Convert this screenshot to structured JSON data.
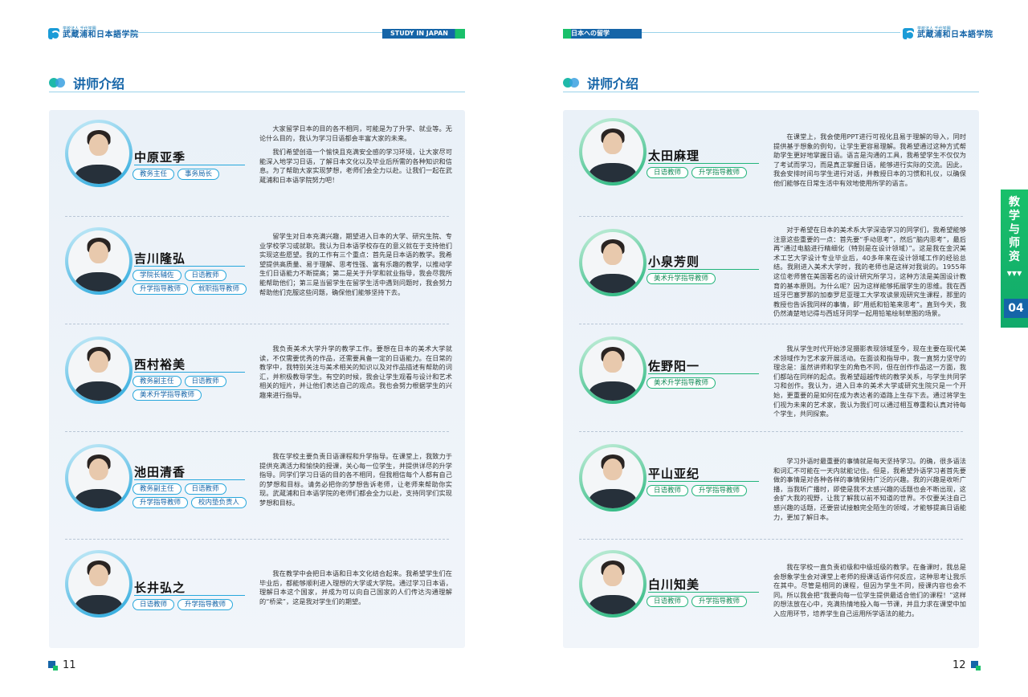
{
  "header": {
    "logo_small": "学校法人 千代学園",
    "logo_name": "武蔵浦和日本語学院",
    "left_tag": "STUDY IN JAPAN",
    "right_tag": "日本への留学"
  },
  "section_title": "讲师介绍",
  "side_tab": {
    "text": "教学与师资",
    "arrow": "▼▼▼",
    "number": "04"
  },
  "left_teachers": [
    {
      "name": "中原亚季",
      "tags": [
        "教务主任",
        "事务局长"
      ],
      "desc": [
        "大家留学日本的目的各不相同，可能是为了升学、就业等。无论什么目的，我认为学习日语都会丰富大家的未来。",
        "我们希望创造一个愉快且充满安全感的学习环境，让大家尽可能深入地学习日语，了解日本文化以及毕业后所需的各种知识和信息。为了帮助大家实现梦想，老师们会全力以赴。让我们一起在武蔵浦和日本语学院努力吧！"
      ]
    },
    {
      "name": "吉川隆弘",
      "tags": [
        "学院长辅佐",
        "日语教师",
        "升学指导教师",
        "就职指导教师"
      ],
      "desc": [
        "留学生对日本充满兴趣，期望进入日本的大学、研究生院、专业学校学习或就职。我认为日本语学校存在的意义就在于支持他们实现这些愿望。我的工作有三个重点：首先是日本语的教学。我希望提供高质量、易于理解、思考性强、富有乐趣的教学，以推动学生们日语能力不断提高；第二是关于升学和就业指导，我会尽我所能帮助他们；第三是当留学生在留学生活中遇到问题时，我会努力帮助他们克服这些问题，确保他们能够坚持下去。"
      ]
    },
    {
      "name": "西村裕美",
      "tags": [
        "教务副主任",
        "日语教师",
        "美术升学指导教师"
      ],
      "desc": [
        "我负责美术大学升学的教学工作。要想在日本的美术大学就读，不仅需要优秀的作品，还需要具备一定的日语能力。在日常的教学中，我特别关注与美术相关的知识以及对作品描述有帮助的词汇，并积极教导学生。有空的时候，我会让学生观看与设计和艺术相关的短片，并让他们表达自己的观点。我也会努力根据学生的兴趣来进行指导。"
      ]
    },
    {
      "name": "池田清香",
      "tags": [
        "教务副主任",
        "日语教师",
        "升学指导教师",
        "校内垫负责人"
      ],
      "desc": [
        "我在学校主要负责日语课程和升学指导。在课堂上，我致力于提供充满活力和愉快的授课，关心每一位学生，并提供详尽的升学指导。同学们学习日语的目的各不相同，但我相信每个人都有自己的梦想和目标。请务必把你的梦想告诉老师，让老师来帮助你实现。武蔵浦和日本语学院的老师们都会全力以赴，支持同学们实现梦想和目标。"
      ]
    },
    {
      "name": "长井弘之",
      "tags": [
        "日语教师",
        "升学指导教师"
      ],
      "desc": [
        "我在教学中会把日本语和日本文化结合起来。我希望学生们在毕业后，都能够顺利进入理想的大学或大学院。通过学习日本语，理解日本这个国家，并成为可以向自己国家的人们传达沟通理解的“桥梁”，这是我对学生们的期望。"
      ]
    }
  ],
  "right_teachers": [
    {
      "name": "太田麻理",
      "tags": [
        "日语教师",
        "升学指导教师"
      ],
      "desc": [
        "在课堂上，我会使用PPT进行可视化且易于理解的导入，同时提供基于想象的例句，让学生更容易理解。我希望通过这种方式帮助学生更好地掌握日语。语言是沟通的工具，我希望学生不仅仅为了考试而学习，而是真正掌握日语，能够进行实际的交流。因此，我会安排时间与学生进行对话，并教授日本的习惯和礼仪，以确保他们能够在日常生活中有效地使用所学的语言。"
      ]
    },
    {
      "name": "小泉芳则",
      "tags": [
        "美术升学指导教师"
      ],
      "desc": [
        "对于希望在日本的美术系大学深造学习的同学们，我希望能够注意这些重要的一点：首先要“手动思考”，然后“脑内思考”，最后再“通过电脑进行精细化（特别是在设计领域）”。这是我在金沢美术工艺大学设计专业毕业后，40多年来在设计领域工作的经验总结。我刚进入美术大学时，我的老师也是这样对我说的。1955年这位老师曾在美国著名的设计研究所学习，这种方法是美国设计教育的基本原则。为什么呢？因为这样能够拓展学生的思维。我在西班牙巴塞罗那的加泰罗尼亚理工大学攻读景观研究生课程，那里的教授也告诉我同样的事情，即“用纸和铅笔来思考”。直到今天，我仍然清楚地记得与西班牙同学一起用铅笔绘制草图的场景。"
      ]
    },
    {
      "name": "佐野阳一",
      "tags": [
        "美术升学指导教师"
      ],
      "desc": [
        "我从学生时代开始涉足摄影表现领域至今，现在主要在现代美术领域作为艺术家开展活动。在面谈和指导中，我一直努力坚守的理念是：虽然讲师和学生的角色不同，但在创作作品这一方面，我们都站在同样的起点。我希望超越传统的教学关系，与学生共同学习和创作。我认为，进入日本的美术大学或研究生院只是一个开始，更重要的是如何在成为表达者的道路上生存下去。通过将学生们视为未来的艺术家，我认为我们可以通过相互尊重和认真对待每个学生，共同探索。"
      ]
    },
    {
      "name": "平山亚纪",
      "tags": [
        "日语教师",
        "升学指导教师"
      ],
      "desc": [
        "学习外语时最重要的事情就是每天坚持学习。的确，很多语法和词汇不可能在一天内就能记住。但是，我希望外语学习者首先要做的事情是对各种各样的事情保持广泛的兴趣。我的兴趣是收听广播，当我听广播时，即使是我不太感兴趣的话题也会不断出现，这会扩大我的视野，让我了解我以前不知道的世界。不仅要关注自己感兴趣的话题，还要尝试接触完全陌生的领域，才能够提高日语能力，更加了解日本。"
      ]
    },
    {
      "name": "白川知美",
      "tags": [
        "日语教师",
        "升学指导教师"
      ],
      "desc": [
        "我在学校一直负责初级和中级班级的教学。在备课时，我总是会想象学生会对课堂上老师的授课话语作何反应，这种思考让我乐在其中。尽管是相同的课程，但因为学生不同，授课内容也会不同。所以我会把“我要向每一位学生提供最适合他们的课程！”这样的想法放在心中，充满热情地投入每一节课，并且力求在课堂中加入应用环节，培养学生自己运用所学语法的能力。"
      ]
    }
  ],
  "page_numbers": {
    "left": "11",
    "right": "12"
  }
}
